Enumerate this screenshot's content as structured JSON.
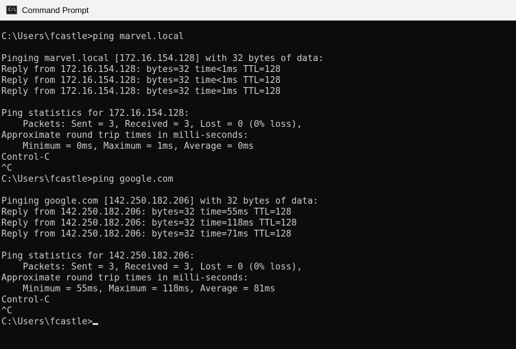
{
  "window": {
    "title": "Command Prompt",
    "icon": "cmd-icon",
    "icon_glyph": "C:\\"
  },
  "console": {
    "lines": [
      "C:\\Users\\fcastle>ping marvel.local",
      "",
      "Pinging marvel.local [172.16.154.128] with 32 bytes of data:",
      "Reply from 172.16.154.128: bytes=32 time<1ms TTL=128",
      "Reply from 172.16.154.128: bytes=32 time<1ms TTL=128",
      "Reply from 172.16.154.128: bytes=32 time=1ms TTL=128",
      "",
      "Ping statistics for 172.16.154.128:",
      "    Packets: Sent = 3, Received = 3, Lost = 0 (0% loss),",
      "Approximate round trip times in milli-seconds:",
      "    Minimum = 0ms, Maximum = 1ms, Average = 0ms",
      "Control-C",
      "^C",
      "C:\\Users\\fcastle>ping google.com",
      "",
      "Pinging google.com [142.250.182.206] with 32 bytes of data:",
      "Reply from 142.250.182.206: bytes=32 time=55ms TTL=128",
      "Reply from 142.250.182.206: bytes=32 time=118ms TTL=128",
      "Reply from 142.250.182.206: bytes=32 time=71ms TTL=128",
      "",
      "Ping statistics for 142.250.182.206:",
      "    Packets: Sent = 3, Received = 3, Lost = 0 (0% loss),",
      "Approximate round trip times in milli-seconds:",
      "    Minimum = 55ms, Maximum = 118ms, Average = 81ms",
      "Control-C",
      "^C"
    ],
    "prompt": "C:\\Users\\fcastle>"
  },
  "colors": {
    "background": "#0c0c0c",
    "foreground": "#cccccc",
    "titlebar": "#f3f3f3"
  }
}
